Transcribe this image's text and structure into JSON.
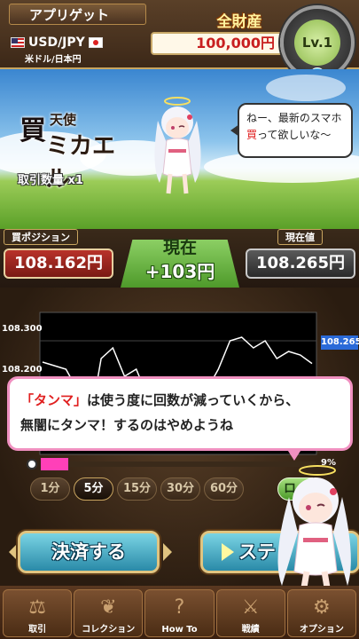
{
  "header": {
    "player_name": "アプリゲット",
    "pair": "USD/JPY",
    "pair_sub": "米ドル/日本円",
    "assets_label": "全財産",
    "assets_value": "100,000円",
    "level": "Lv.1"
  },
  "scene": {
    "title_buy": "買",
    "title_tenshi": "天使",
    "title_name": "ミカエル",
    "lot_label": "取引数量 x1",
    "speech_line1": "ねー、最新のスマホ",
    "speech_red": "買",
    "speech_line2_rest": "って欲しいな〜"
  },
  "positions": {
    "buy_label": "買ポジション",
    "buy_value": "108.162円",
    "now_title": "現在",
    "now_profit": "+103円",
    "current_label": "現在値",
    "current_value": "108.265円"
  },
  "chart_data": {
    "type": "line",
    "yticks": [
      "108.300",
      "108.200"
    ],
    "ylim": [
      108.14,
      108.34
    ],
    "current_marker": "108.265",
    "values": [
      108.27,
      108.265,
      108.26,
      108.23,
      108.18,
      108.275,
      108.29,
      108.25,
      108.26,
      108.22,
      108.2,
      108.24,
      108.21,
      108.225,
      108.23,
      108.26,
      108.3,
      108.305,
      108.29,
      108.3,
      108.275,
      108.285,
      108.28,
      108.268
    ]
  },
  "tutorial": {
    "red_text": "「タンマ」",
    "line1_rest": "は使う度に回数が減っていくから、",
    "line2": "無闇にタンマ！するのはやめようね"
  },
  "timer": {
    "percent": "9%",
    "fill": 0.09
  },
  "periods": [
    "1分",
    "5分",
    "15分",
    "30分",
    "60分"
  ],
  "active_period": "5分",
  "side_button": "ロ",
  "buttons": {
    "close": "決済する",
    "step": "ステ"
  },
  "nav": [
    {
      "label": "取引",
      "icon": "scale-icon"
    },
    {
      "label": "コレクション",
      "icon": "wings-icon"
    },
    {
      "label": "How To",
      "icon": "bulb-icon"
    },
    {
      "label": "戦績",
      "icon": "swords-icon"
    },
    {
      "label": "オプション",
      "icon": "gear-icon"
    }
  ],
  "colors": {
    "profit_green": "#4e9a2a",
    "buy_red": "#b8322a",
    "accent_pink": "#ff40b8",
    "marker_blue": "#2a6ad8"
  }
}
